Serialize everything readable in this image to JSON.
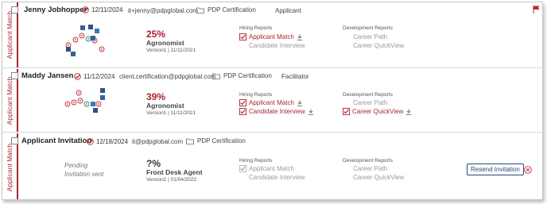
{
  "colors": {
    "accent": "#a8262e",
    "muted": "#9a9a9a",
    "button": "#2a4a78"
  },
  "cards": [
    {
      "side_label": "Applicant Match",
      "name": "Jenny Jobhopper",
      "date": "12/11/2024",
      "email": "it+jenny@pdpglobal.com",
      "certification": "PDP Certification",
      "role": "Applicant",
      "flagged": true,
      "match_percent": "25%",
      "job_title": "Agronomist",
      "version": "Version1 | 11/11/2021",
      "hiring_title": "Hiring Reports",
      "hiring_reports": [
        {
          "label": "Applicant Match",
          "state": "active-download"
        },
        {
          "label": "Candidate Interview",
          "state": "inactive"
        }
      ],
      "dev_title": "Development Reports",
      "dev_reports": [
        {
          "label": "Career Path",
          "state": "inactive"
        },
        {
          "label": "Career QuickView",
          "state": "inactive"
        }
      ]
    },
    {
      "side_label": "Applicant Match",
      "name": "Maddy Jansen",
      "date": "11/12/2024",
      "email": "client.certification@pdpglobal.com",
      "certification": "PDP Certification",
      "role": "Facilitator",
      "match_percent": "39%",
      "job_title": "Agronomist",
      "version": "Version1 | 11/11/2021",
      "hiring_title": "Hiring Reports",
      "hiring_reports": [
        {
          "label": "Applicant Match",
          "state": "checked"
        },
        {
          "label": "Candidate Interview",
          "state": "checked"
        }
      ],
      "dev_title": "Development Reports",
      "dev_reports": [
        {
          "label": "Career Path",
          "state": "inactive"
        },
        {
          "label": "Career QuickView",
          "state": "checked"
        }
      ]
    },
    {
      "side_label": "Applicant Match",
      "name": "Applicant Invitation",
      "date": "12/18/2024",
      "email": "it@pdpglobal.com",
      "certification": "PDP Certification",
      "pending_line1": "Pending",
      "pending_line2": "Invitation sent",
      "match_percent": "?%",
      "job_title": "Front Desk Agent",
      "version": "Version2 | 01/04/2022",
      "hiring_title": "Hiring Reports",
      "hiring_reports": [
        {
          "label": "Applicant Match",
          "state": "grey-checked"
        },
        {
          "label": "Candidate Interview",
          "state": "inactive"
        }
      ],
      "dev_title": "Development Reports",
      "dev_reports": [
        {
          "label": "Career Path",
          "state": "inactive"
        },
        {
          "label": "Career QuickView",
          "state": "inactive"
        }
      ],
      "resend_label": "Resend Invitation"
    }
  ],
  "icons": {
    "date_check": "check-circle-icon",
    "certification": "folder-icon",
    "download": "download-icon",
    "flag": "flag-icon",
    "close": "close-circle-icon"
  }
}
